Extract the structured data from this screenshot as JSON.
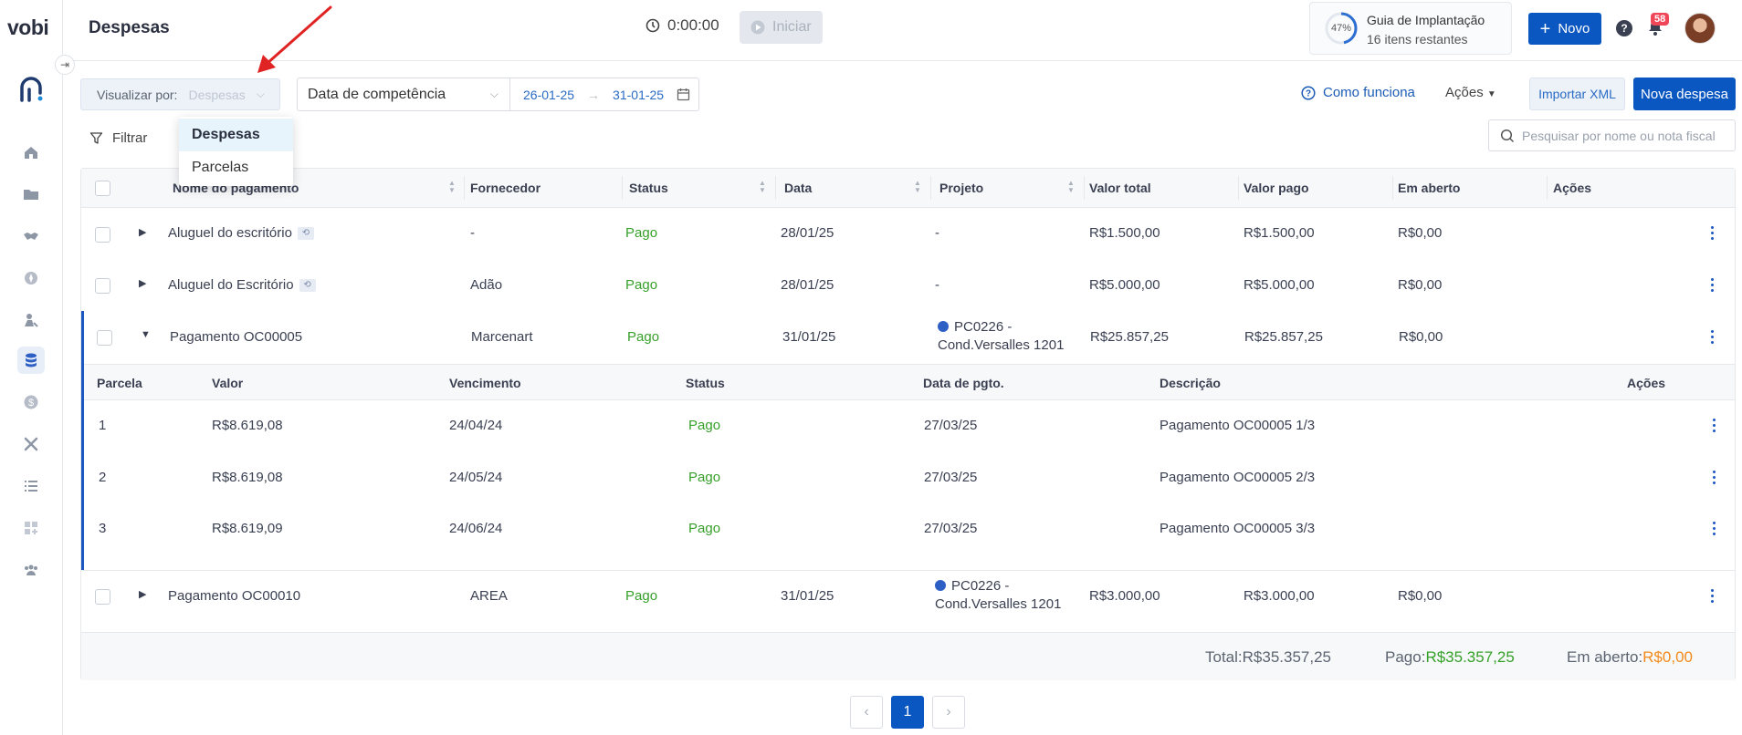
{
  "app": {
    "logo": "vobi",
    "page_title": "Despesas"
  },
  "header": {
    "timer": "0:00:00",
    "iniciar_label": "Iniciar",
    "guide_percent": "47%",
    "guide_progress": 0.47,
    "guide_title": "Guia de Implantação",
    "guide_subtitle": "16 itens restantes",
    "novo_label": "Novo",
    "help_label": "?",
    "notifications_count": "58"
  },
  "toolbar": {
    "view_by_label": "Visualizar por:",
    "view_by_value": "Despesas",
    "date_type": "Data de competência",
    "date_start": "26-01-25",
    "date_end": "31-01-25",
    "como_funciona": "Como funciona",
    "acoes": "Ações",
    "importar_xml": "Importar XML",
    "nova_despesa": "Nova despesa",
    "filtrar": "Filtrar",
    "search_placeholder": "Pesquisar por nome ou nota fiscal"
  },
  "dropdown": {
    "options": [
      "Despesas",
      "Parcelas"
    ],
    "selected": "Despesas"
  },
  "table": {
    "columns": [
      "Nome do pagamento",
      "Fornecedor",
      "Status",
      "Data",
      "Projeto",
      "Valor total",
      "Valor pago",
      "Em aberto",
      "Ações"
    ],
    "rows": [
      {
        "name": "Aluguel do escritório",
        "supplier": "-",
        "status": "Pago",
        "date": "28/01/25",
        "project": "-",
        "total": "R$1.500,00",
        "paid": "R$1.500,00",
        "open": "R$0,00"
      },
      {
        "name": "Aluguel do Escritório",
        "supplier": "Adão",
        "status": "Pago",
        "date": "28/01/25",
        "project": "-",
        "total": "R$5.000,00",
        "paid": "R$5.000,00",
        "open": "R$0,00"
      },
      {
        "name": "Pagamento OC00005",
        "supplier": "Marcenart",
        "status": "Pago",
        "date": "31/01/25",
        "project_line1": "PC0226 -",
        "project_line2": "Cond.Versalles 1201",
        "total": "R$25.857,25",
        "paid": "R$25.857,25",
        "open": "R$0,00"
      },
      {
        "name": "Pagamento OC00010",
        "supplier": "AREA",
        "status": "Pago",
        "date": "31/01/25",
        "project_line1": "PC0226 -",
        "project_line2": "Cond.Versalles 1201",
        "total": "R$3.000,00",
        "paid": "R$3.000,00",
        "open": "R$0,00"
      }
    ],
    "installments": {
      "columns": [
        "Parcela",
        "Valor",
        "Vencimento",
        "Status",
        "Data de pgto.",
        "Descrição",
        "Ações"
      ],
      "rows": [
        {
          "n": "1",
          "value": "R$8.619,08",
          "due": "24/04/24",
          "status": "Pago",
          "paid_date": "27/03/25",
          "desc": "Pagamento OC00005 1/3"
        },
        {
          "n": "2",
          "value": "R$8.619,08",
          "due": "24/05/24",
          "status": "Pago",
          "paid_date": "27/03/25",
          "desc": "Pagamento OC00005 2/3"
        },
        {
          "n": "3",
          "value": "R$8.619,09",
          "due": "24/06/24",
          "status": "Pago",
          "paid_date": "27/03/25",
          "desc": "Pagamento OC00005 3/3"
        }
      ]
    },
    "footer": {
      "total_label": "Total:",
      "total_value": "R$35.357,25",
      "paid_label": "Pago:",
      "paid_value": "R$35.357,25",
      "open_label": "Em aberto:",
      "open_value": "R$0,00"
    }
  },
  "pagination": {
    "prev": "‹",
    "current": "1",
    "next": "›"
  },
  "colors": {
    "primary": "#0b57c2",
    "paid_green": "#36a02a",
    "open_orange": "#f28a1c",
    "arrow_red": "#e02424"
  },
  "sidebar_icons": [
    "home-icon",
    "folder-icon",
    "handshake-icon",
    "compass-icon",
    "engineer-icon",
    "coins-icon",
    "dollar-icon",
    "tools-icon",
    "list-icon",
    "apps-icon",
    "team-icon"
  ]
}
